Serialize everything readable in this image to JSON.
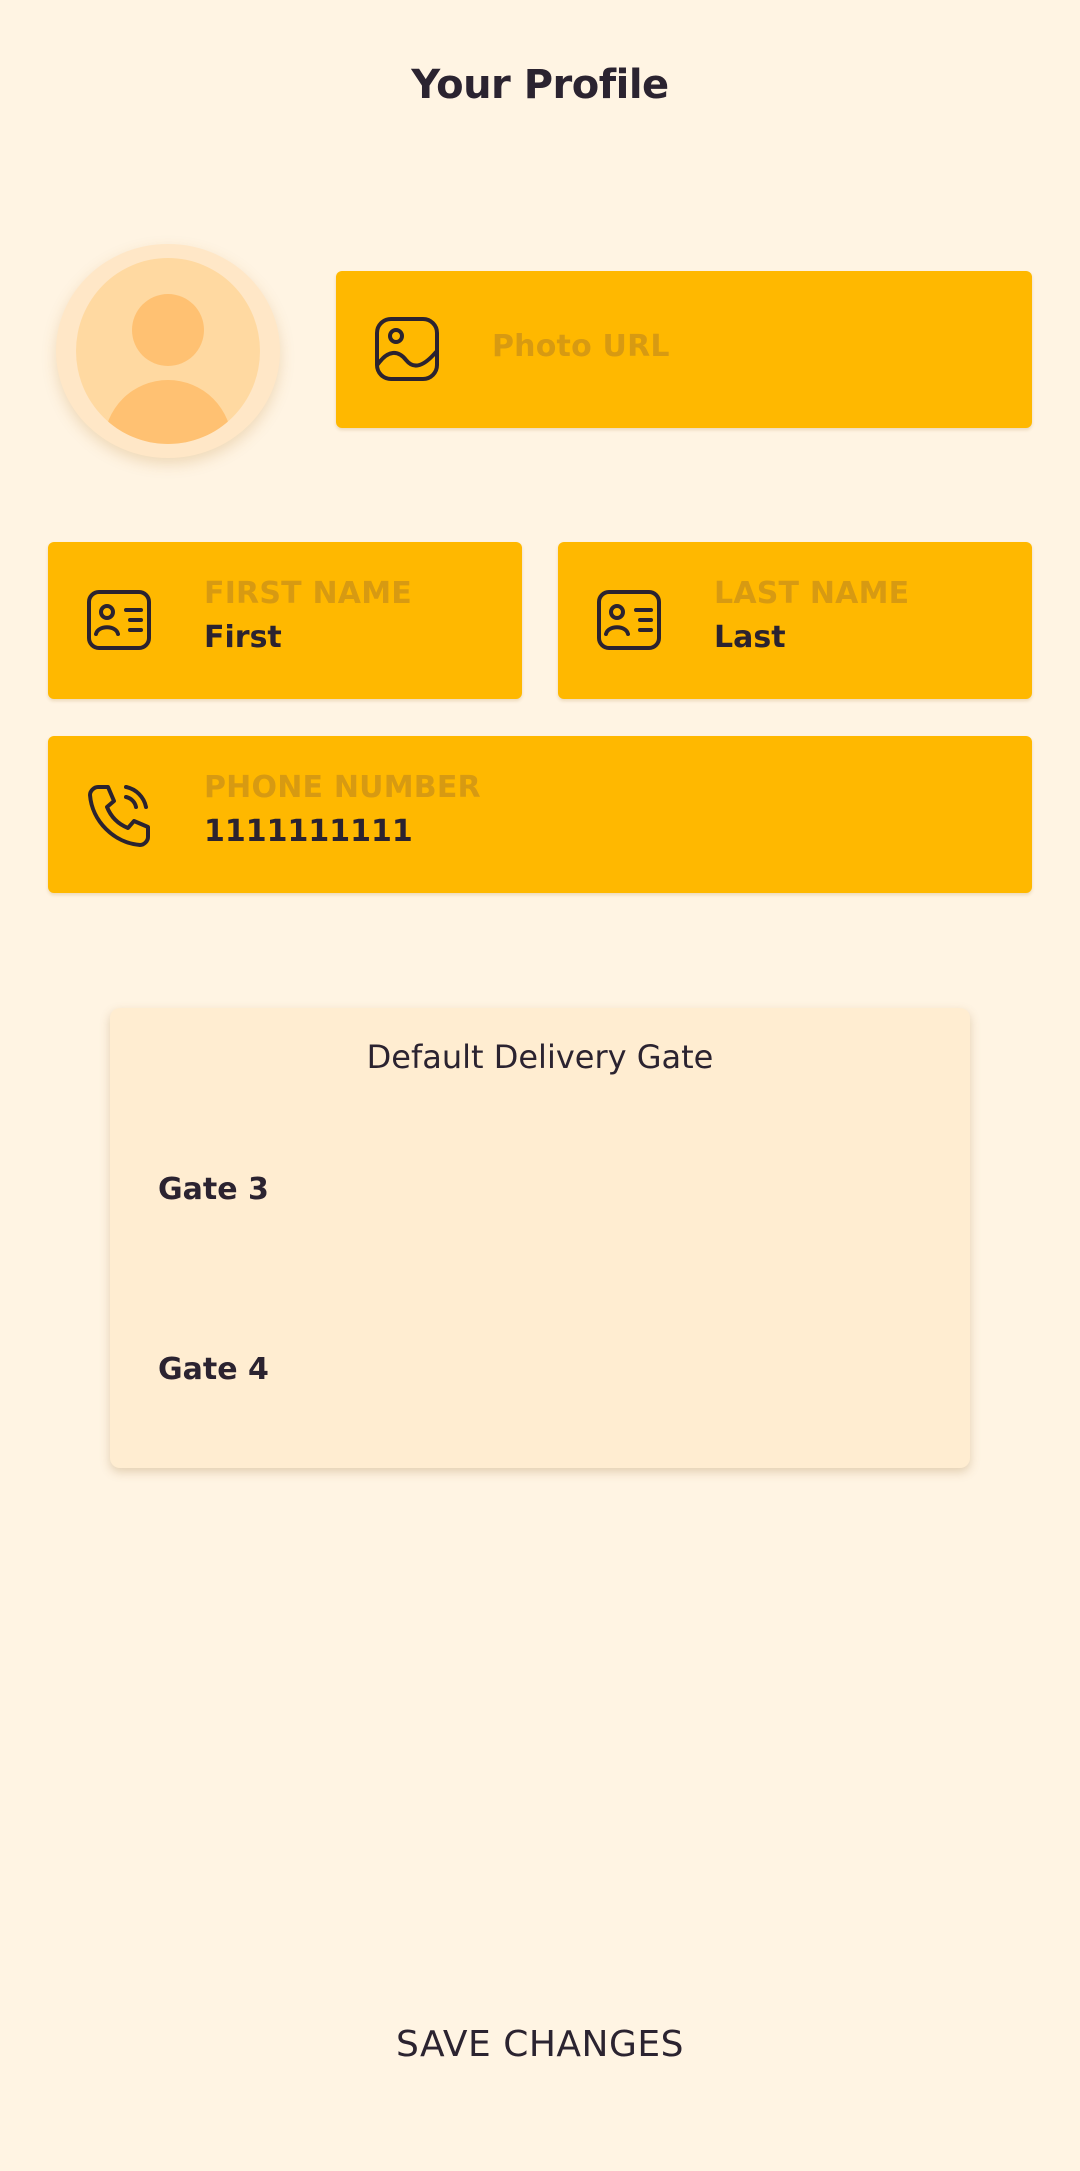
{
  "header": {
    "title": "Your Profile"
  },
  "photo": {
    "placeholder": "Photo URL",
    "icon": "image-icon"
  },
  "first_name": {
    "label": "FIRST NAME",
    "value": "First",
    "icon": "id-card-icon"
  },
  "last_name": {
    "label": "LAST NAME",
    "value": "Last",
    "icon": "id-card-icon"
  },
  "phone": {
    "label": "PHONE NUMBER",
    "value": "1111111111",
    "icon": "phone-icon"
  },
  "delivery_gate": {
    "title": "Default Delivery Gate",
    "options": [
      "Gate 3",
      "Gate 4"
    ]
  },
  "actions": {
    "save_label": "SAVE CHANGES"
  },
  "colors": {
    "background": "#FFF4E3",
    "field": "#FFB800",
    "field_label": "#D79A12",
    "text": "#2B2330",
    "card": "#FFEDD1"
  }
}
